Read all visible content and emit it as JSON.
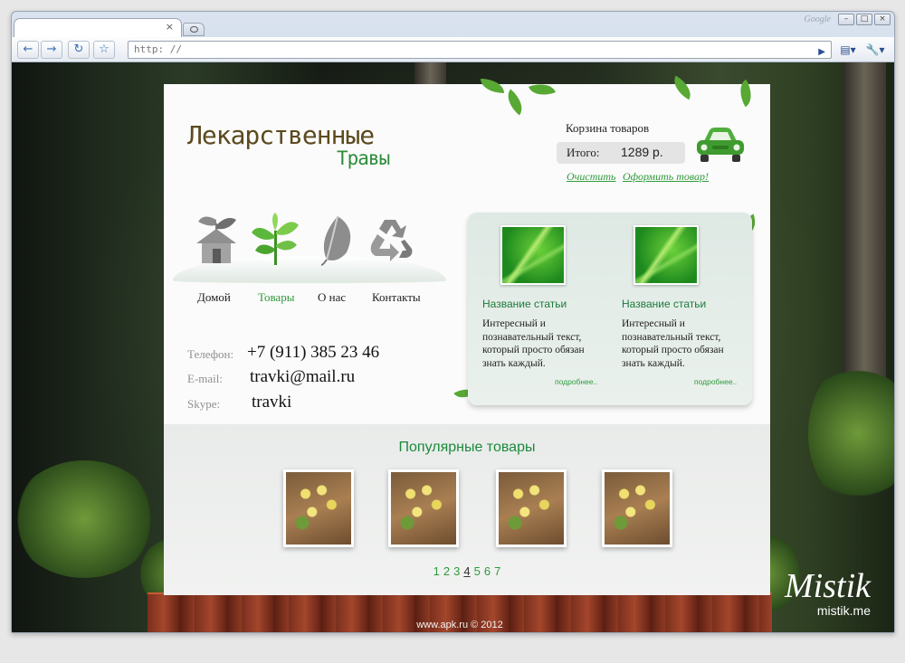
{
  "browser": {
    "brand": "Google",
    "address": "http: //",
    "tab_close": "×"
  },
  "logo": {
    "line1": "Лекарственные",
    "line2": "Травы"
  },
  "cart": {
    "title": "Корзина товаров",
    "total_label": "Итого:",
    "total_value": "1289 р.",
    "clear_link": "Очистить",
    "checkout_link": "Оформить товар!"
  },
  "nav": {
    "items": [
      {
        "label": "Домой",
        "icon": "home-icon",
        "active": false
      },
      {
        "label": "Товары",
        "icon": "plant-icon",
        "active": true
      },
      {
        "label": "О нас",
        "icon": "leaf-icon",
        "active": false
      },
      {
        "label": "Контакты",
        "icon": "recycle-icon",
        "active": false
      }
    ]
  },
  "contacts": {
    "phone_label": "Телефон:",
    "phone": "+7 (911) 385 23 46",
    "email_label": "E-mail:",
    "email": "travki@mail.ru",
    "skype_label": "Skype:",
    "skype": "travki"
  },
  "articles": [
    {
      "title": "Название статьи",
      "text": "Интересный и познавательный текст, который просто обязан знать каждый.",
      "more": "подробнее.."
    },
    {
      "title": "Название статьи",
      "text": "Интересный и познавательный текст, который просто обязан знать каждый.",
      "more": "подробнее.."
    }
  ],
  "popular": {
    "title": "Популярные товары",
    "pages": [
      "1",
      "2",
      "3",
      "4",
      "5",
      "6",
      "7"
    ],
    "current_page": "4"
  },
  "footer": {
    "text": "www.apk.ru © 2012"
  },
  "watermark": {
    "name": "Mistik",
    "site": "mistik.me"
  },
  "colors": {
    "accent": "#2f9a3c",
    "logo_brown": "#5c4a1f"
  }
}
